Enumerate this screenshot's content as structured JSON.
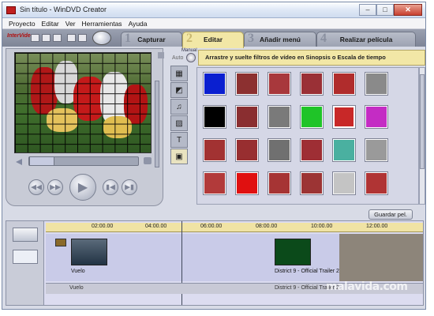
{
  "window": {
    "title": "Sin título - WinDVD Creator"
  },
  "menu": [
    "Proyecto",
    "Editar",
    "Ver",
    "Herramientas",
    "Ayuda"
  ],
  "tabs": [
    {
      "num": "1",
      "label": "Capturar",
      "active": false
    },
    {
      "num": "2",
      "label": "Editar",
      "active": true
    },
    {
      "num": "3",
      "label": "Añadir menú",
      "active": false
    },
    {
      "num": "4",
      "label": "Realizar película",
      "active": false
    }
  ],
  "mode": {
    "manual": "Manual",
    "auto": "Auto"
  },
  "instruction": "Arrastre y suelte filtros de vídeo en Sinopsis o Escala de tiempo",
  "save_button": "Guardar pel.",
  "timeline": {
    "ticks": [
      "02:00.00",
      "04:00.00",
      "06:00.00",
      "08:00.00",
      "10:00.00",
      "12:00.00"
    ],
    "clips": [
      {
        "label": "Vuelo"
      },
      {
        "label": "District 9 - Official Trailer 2"
      }
    ],
    "audio": [
      "Vuelo",
      "District 9 - Official Trailer 2"
    ]
  },
  "watermark": "malavida.com",
  "colors": {
    "accent": "#f2e7a6",
    "panel": "#d5d7e6"
  }
}
